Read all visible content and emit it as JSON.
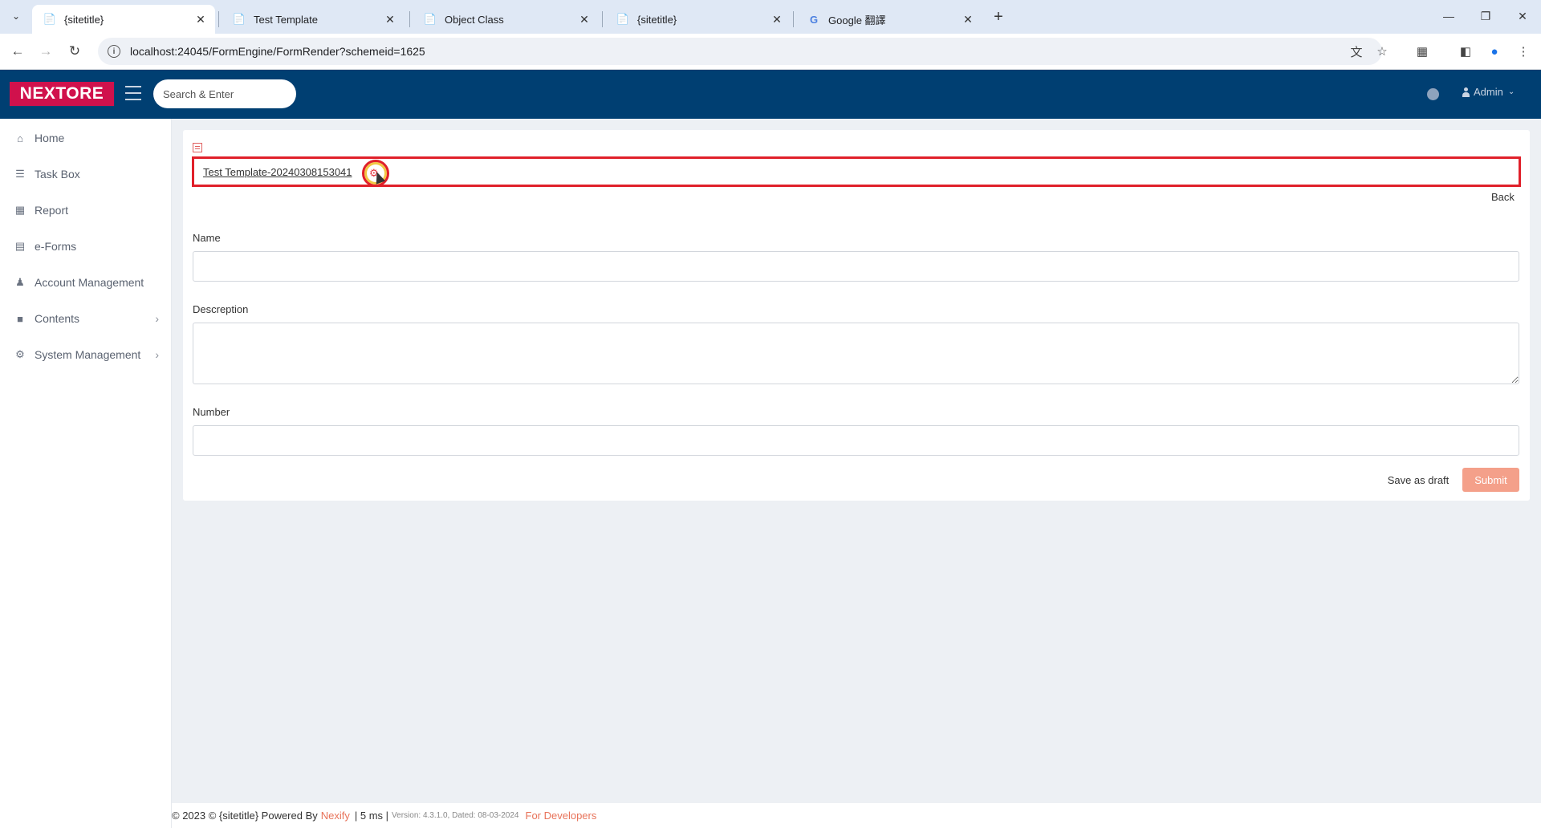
{
  "browser": {
    "tabs": [
      {
        "title": "{sitetitle}",
        "active": true
      },
      {
        "title": "Test Template",
        "active": false
      },
      {
        "title": "Object Class",
        "active": false
      },
      {
        "title": "{sitetitle}",
        "active": false
      },
      {
        "title": "Google 翻譯",
        "active": false
      }
    ],
    "url": "localhost:24045/FormEngine/FormRender?schemeid=1625"
  },
  "header": {
    "logo": "NEXTORE",
    "search_placeholder": "Search & Enter",
    "user": "Admin"
  },
  "sidebar": {
    "items": [
      {
        "label": "Home",
        "icon": "home-icon"
      },
      {
        "label": "Task Box",
        "icon": "tasks-icon"
      },
      {
        "label": "Report",
        "icon": "table-icon"
      },
      {
        "label": "e-Forms",
        "icon": "form-icon"
      },
      {
        "label": "Account Management",
        "icon": "user-icon"
      },
      {
        "label": "Contents",
        "icon": "folder-icon",
        "expandable": true
      },
      {
        "label": "System Management",
        "icon": "gears-icon",
        "expandable": true
      }
    ]
  },
  "form": {
    "title": "Test Template-20240308153041",
    "back_label": "Back",
    "fields": {
      "name_label": "Name",
      "name_value": "",
      "description_label": "Descreption",
      "description_value": "",
      "number_label": "Number",
      "number_value": ""
    },
    "save_draft_label": "Save as draft",
    "submit_label": "Submit"
  },
  "footer": {
    "copyright": "© 2023 © {sitetitle} Powered By",
    "brand": "Nexify",
    "timing": "| 5 ms |",
    "version": "Version: 4.3.1.0, Dated: 08-03-2024",
    "dev_link": "For Developers"
  },
  "colors": {
    "header_bg": "#003f72",
    "logo_bg": "#d0114c",
    "highlight_border": "#e0202a",
    "submit_bg": "#f4a08a",
    "accent": "#e8735a"
  }
}
